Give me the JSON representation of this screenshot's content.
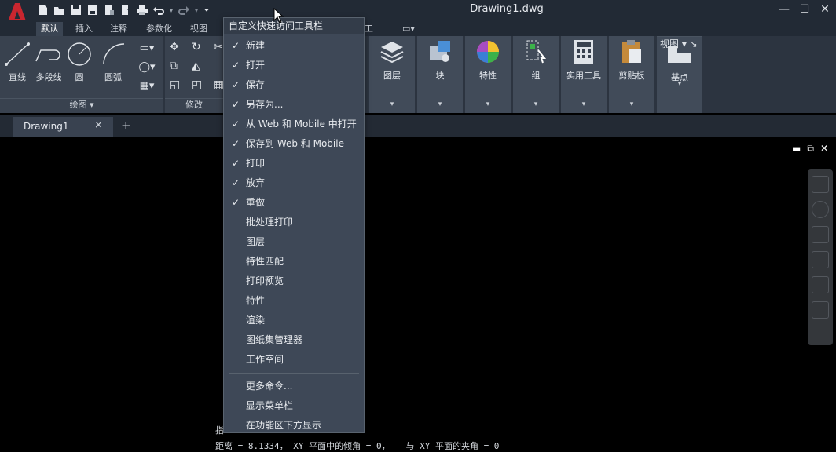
{
  "window": {
    "title": "Drawing1.dwg"
  },
  "ribbon_tabs": [
    "默认",
    "插入",
    "注释",
    "参数化",
    "视图",
    "工"
  ],
  "panels": {
    "draw": {
      "title": "绘图",
      "tools": [
        "直线",
        "多段线",
        "圆",
        "圆弧"
      ]
    },
    "modify": {
      "title": "修改"
    },
    "big_buttons": [
      "图层",
      "块",
      "特性",
      "组",
      "实用工具",
      "剪贴板",
      "基点"
    ],
    "view_title": "视图"
  },
  "doc_tab": {
    "label": "Drawing1",
    "close": "×",
    "add": "+"
  },
  "menu": {
    "header": "自定义快速访问工具栏",
    "items": [
      {
        "label": "新建",
        "checked": "✓"
      },
      {
        "label": "打开",
        "checked": "✓"
      },
      {
        "label": "保存",
        "checked": "✓"
      },
      {
        "label": "另存为...",
        "checked": "✓"
      },
      {
        "label": "从 Web 和 Mobile 中打开",
        "checked": "✓"
      },
      {
        "label": "保存到 Web 和 Mobile",
        "checked": "✓"
      },
      {
        "label": "打印",
        "checked": "✓"
      },
      {
        "label": "放弃",
        "checked": "✓"
      },
      {
        "label": "重做",
        "checked": "✓"
      },
      {
        "label": "批处理打印",
        "checked": ""
      },
      {
        "label": "图层",
        "checked": ""
      },
      {
        "label": "特性匹配",
        "checked": ""
      },
      {
        "label": "打印预览",
        "checked": ""
      },
      {
        "label": "特性",
        "checked": ""
      },
      {
        "label": "渲染",
        "checked": ""
      },
      {
        "label": "图纸集管理器",
        "checked": ""
      },
      {
        "label": "工作空间",
        "checked": ""
      }
    ],
    "extra": [
      "更多命令...",
      "显示菜单栏",
      "在功能区下方显示"
    ]
  },
  "command_line": {
    "line1": "指",
    "line2": "距离 = 8.1334， XY 平面中的倾角 = 0，   与 XY 平面的夹角 = 0"
  },
  "colors": {
    "accent": "#c9262f",
    "menu_bg": "#3e4857",
    "ribbon_bg": "#2c3440"
  }
}
